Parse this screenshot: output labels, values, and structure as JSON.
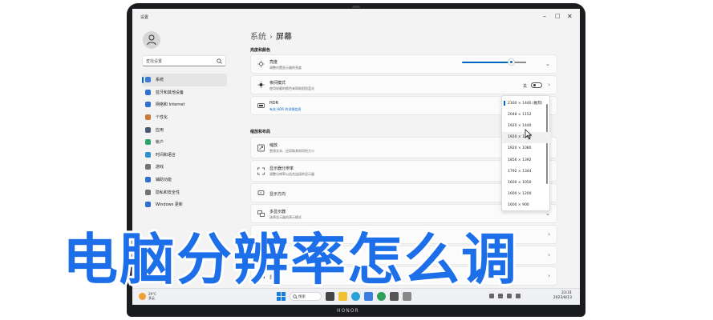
{
  "window": {
    "app_name": "设置"
  },
  "breadcrumb": {
    "parent": "系统",
    "current": "屏幕"
  },
  "search": {
    "placeholder": "查找设置"
  },
  "nav": [
    {
      "label": "系统",
      "icon": "monitor-icon",
      "color": "#3a7bd5",
      "active": true
    },
    {
      "label": "蓝牙和其他设备",
      "icon": "bluetooth-icon",
      "color": "#2f6fd0"
    },
    {
      "label": "网络和 Internet",
      "icon": "wifi-icon",
      "color": "#2f6fd0"
    },
    {
      "label": "个性化",
      "icon": "brush-icon",
      "color": "#c9793a"
    },
    {
      "label": "应用",
      "icon": "apps-icon",
      "color": "#4a5a70"
    },
    {
      "label": "帐户",
      "icon": "person-icon",
      "color": "#2fa36b"
    },
    {
      "label": "时间和语言",
      "icon": "globe-icon",
      "color": "#2f8fd0"
    },
    {
      "label": "游戏",
      "icon": "gamepad-icon",
      "color": "#707070"
    },
    {
      "label": "辅助功能",
      "icon": "accessibility-icon",
      "color": "#2f6fd0"
    },
    {
      "label": "隐私和安全性",
      "icon": "shield-icon",
      "color": "#707070"
    },
    {
      "label": "Windows 更新",
      "icon": "update-icon",
      "color": "#2f6fd0"
    }
  ],
  "sections": {
    "brightness_color": "亮度和颜色",
    "scale_layout": "缩放和布局"
  },
  "cards": {
    "brightness": {
      "title": "亮度",
      "subtitle": "调整内置显示器的亮度",
      "level": 0.82
    },
    "night_light": {
      "title": "夜间模式",
      "subtitle": "使用较暖的颜色来帮助阻挡蓝光",
      "toggle_label": "关"
    },
    "hdr": {
      "title": "HDR",
      "subtitle": "有关 HDR 的详细信息"
    },
    "scale": {
      "title": "缩放",
      "subtitle": "更改文本、应用和其他项的大小"
    },
    "resolution": {
      "title": "显示器分辨率",
      "subtitle": "调整分辨率以适合连接的显示器"
    },
    "orientation": {
      "title": "显示方向"
    },
    "multi_display": {
      "title": "多显示器",
      "subtitle": "选择显示器的演示模式"
    },
    "graphics": {
      "title": "显示卡"
    }
  },
  "resolution_options": [
    "2160 × 1440 (推荐)",
    "2048 × 1152",
    "1920 × 1440",
    "1920 × 1200",
    "1920 × 1080",
    "1856 × 1392",
    "1792 × 1344",
    "1600 × 1050",
    "1600 × 1200",
    "1600 × 900"
  ],
  "taskbar": {
    "weather_temp": "29°C",
    "weather_desc": "多云",
    "search_label": "搜索",
    "time": "23:31",
    "date": "2023/8/13"
  },
  "device_brand": "HONOR",
  "headline": "电脑分辨率怎么调"
}
